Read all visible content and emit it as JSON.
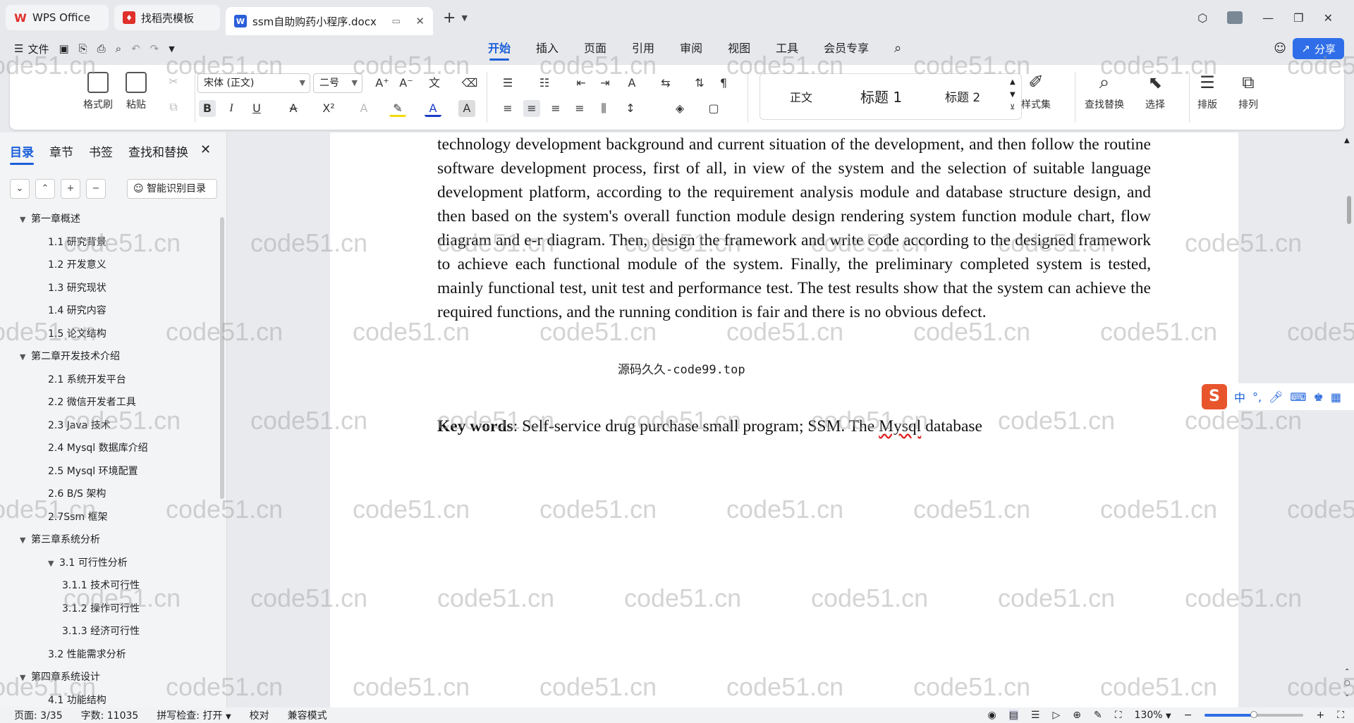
{
  "tabs": [
    {
      "label": "WPS Office",
      "icon": "wps-logo-icon",
      "color": "#e0302b"
    },
    {
      "label": "找稻壳模板",
      "icon": "docer-icon",
      "color": "#e0302b"
    },
    {
      "label": "ssm自助购药小程序.docx",
      "icon": "word-doc-icon",
      "color": "#2b5fd9"
    }
  ],
  "menu": {
    "file": "文件",
    "tabs": [
      "开始",
      "插入",
      "页面",
      "引用",
      "审阅",
      "视图",
      "工具",
      "会员专享"
    ],
    "active_tab": "开始",
    "share": "分享"
  },
  "ribbon": {
    "format_painter": "格式刷",
    "paste": "粘贴",
    "font_name": "宋体 (正文)",
    "font_size": "二号",
    "styles": [
      "正文",
      "标题 1",
      "标题 2"
    ],
    "style_set": "样式集",
    "find_replace": "查找替换",
    "select": "选择",
    "layout": "排版",
    "arrange": "排列",
    "bold": "B",
    "italic": "I",
    "underline": "U"
  },
  "leftpane": {
    "tabs": [
      "目录",
      "章节",
      "书签",
      "查找和替换"
    ],
    "smart_toc": "智能识别目录",
    "toc": [
      {
        "label": "第一章概述",
        "level": 0,
        "toggle": "▼"
      },
      {
        "label": "1.1 研究背景",
        "level": 1
      },
      {
        "label": "1.2 开发意义",
        "level": 1
      },
      {
        "label": "1.3  研究现状",
        "level": 1
      },
      {
        "label": "1.4  研究内容",
        "level": 1
      },
      {
        "label": "1.5 论文结构",
        "level": 1
      },
      {
        "label": "第二章开发技术介绍",
        "level": 0,
        "toggle": "▼"
      },
      {
        "label": "2.1  系统开发平台",
        "level": 1
      },
      {
        "label": "2.2 微信开发者工具",
        "level": 1
      },
      {
        "label": "2.3 Java 技术",
        "level": 1
      },
      {
        "label": "2.4 Mysql 数据库介绍",
        "level": 1
      },
      {
        "label": "2.5 Mysql 环境配置",
        "level": 1
      },
      {
        "label": "2.6 B/S 架构",
        "level": 1
      },
      {
        "label": "2.7Ssm 框架",
        "level": 1
      },
      {
        "label": "第三章系统分析",
        "level": 0,
        "toggle": "▼"
      },
      {
        "label": "3.1  可行性分析",
        "level": 1,
        "toggle": "▼"
      },
      {
        "label": "3.1.1 技术可行性",
        "level": 2
      },
      {
        "label": "3.1.2 操作可行性",
        "level": 2
      },
      {
        "label": "3.1.3 经济可行性",
        "level": 2
      },
      {
        "label": "3.2 性能需求分析",
        "level": 1
      },
      {
        "label": "第四章系统设计",
        "level": 0,
        "toggle": "▼"
      },
      {
        "label": "4.1 功能结构",
        "level": 1
      }
    ]
  },
  "document": {
    "paragraph": "technology development background and current situation of the development, and then follow the routine software development process, first of all, in view of the system and the selection of suitable language development platform, according to the requirement analysis module and database structure design, and then based on the system's overall function module design rendering system function module chart, flow diagram and e-r diagram. Then, design the framework and write code according to the designed framework to achieve each functional module of the system. Finally, the preliminary completed system is tested, mainly functional test, unit test and performance test. The test results show that the system can achieve the required functions, and the running condition is fair and there is no obvious defect.",
    "caption": "源码久久-code99.top",
    "keywords_label": "Key words",
    "keywords_text_a": ": Self-service drug purchase small program; SSM. The ",
    "keywords_misspelled": "Mysql",
    "keywords_text_b": " database",
    "watermark": "code51.cn"
  },
  "ime": {
    "lang": "中"
  },
  "status": {
    "page": "页面: 3/35",
    "words": "字数: 11035",
    "spellcheck": "拼写检查: 打开",
    "proofread": "校对",
    "compat": "兼容模式",
    "zoom": "130%",
    "zoom_fraction": 0.5
  },
  "colors": {
    "accent": "#1a5fd9",
    "share": "#2f6ee8",
    "ime": "#e8552d"
  }
}
